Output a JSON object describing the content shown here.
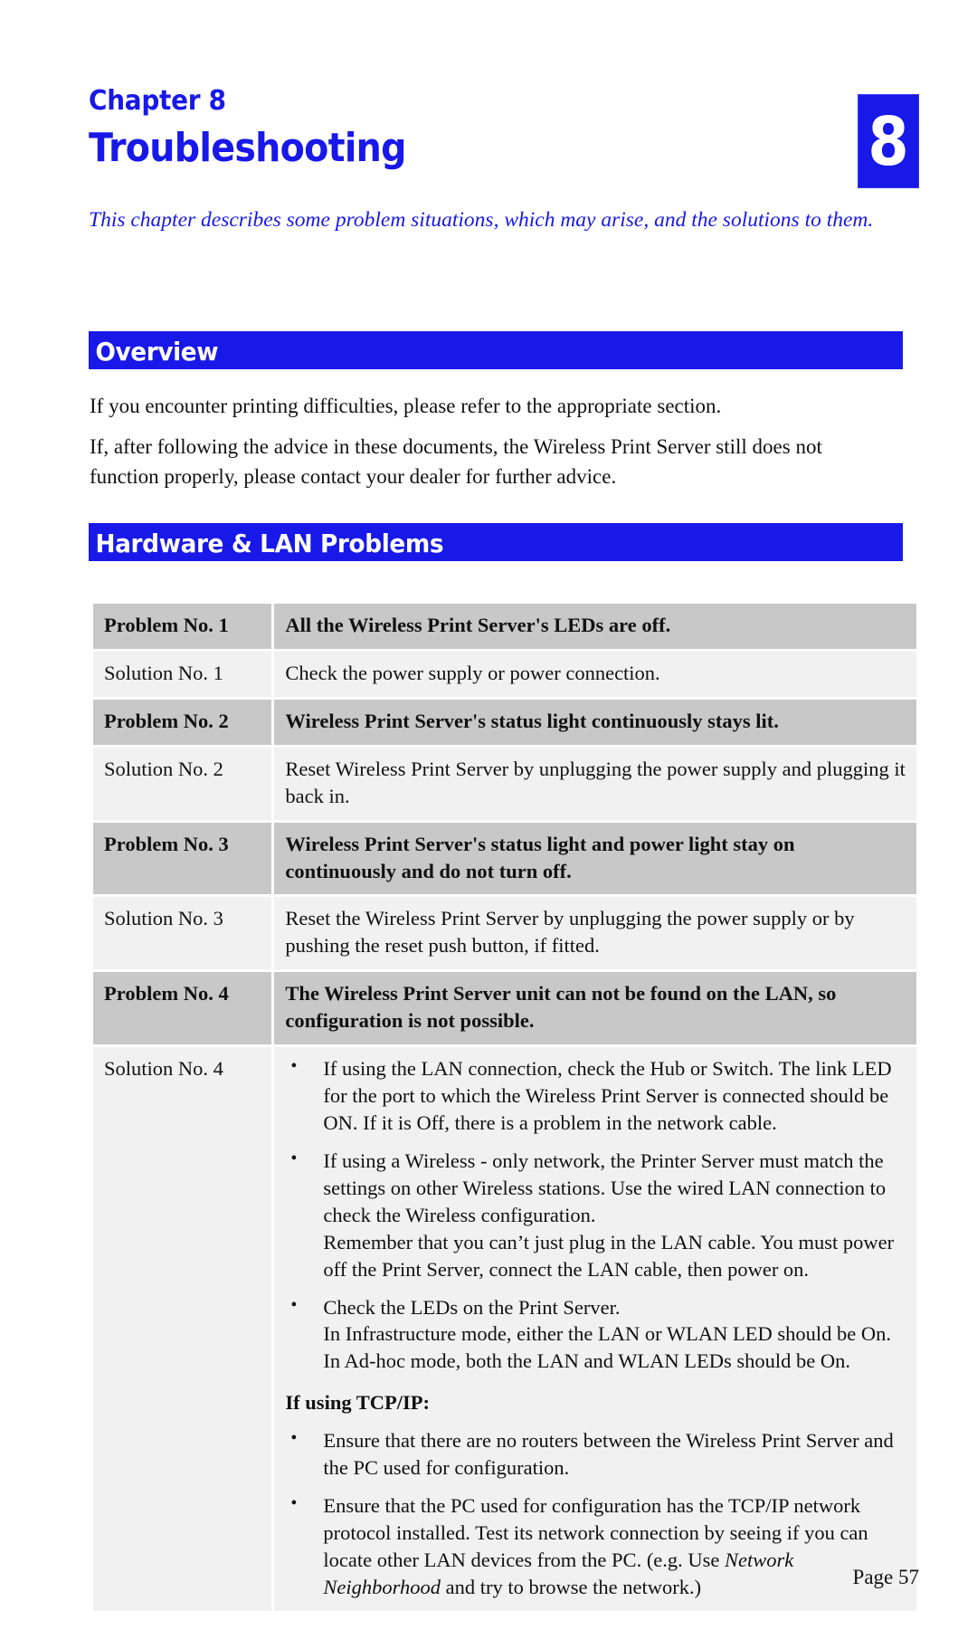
{
  "colors": {
    "accent_blue": "#1818e8",
    "problem_row_bg": "#c8c8c8",
    "solution_row_bg": "#f1f1f1",
    "body_text": "#111111"
  },
  "chapter": {
    "label": "Chapter 8",
    "title": "Troubleshooting",
    "badge_number": "8",
    "intro": "This chapter describes some problem situations, which may arise, and the solutions to them."
  },
  "sections": {
    "overview": {
      "heading": "Overview",
      "paragraphs": [
        "If you encounter printing difficulties, please refer to the appropriate section.",
        "If, after following the advice in these documents, the Wireless Print Server still does not function properly, please contact your dealer for further advice."
      ]
    },
    "hardware_lan": {
      "heading": "Hardware & LAN Problems",
      "rows": [
        {
          "type": "problem",
          "label": "Problem No. 1",
          "text": "All the Wireless Print Server's LEDs are off."
        },
        {
          "type": "solution",
          "label": "Solution No. 1",
          "text": "Check the power supply or power connection."
        },
        {
          "type": "problem",
          "label": "Problem No. 2",
          "text": "Wireless Print Server's status light continuously stays lit."
        },
        {
          "type": "solution",
          "label": "Solution No. 2",
          "text": "Reset Wireless Print Server by unplugging the power supply and plugging it back in."
        },
        {
          "type": "problem",
          "label": "Problem No. 3",
          "text": "Wireless Print Server's status light and power light stay on continuously and do not turn off."
        },
        {
          "type": "solution",
          "label": "Solution No. 3",
          "text": "Reset the Wireless Print Server by unplugging the power supply or by pushing the reset push button, if fitted."
        },
        {
          "type": "problem",
          "label": "Problem No. 4",
          "text": "The Wireless Print Server unit can not be found on the LAN, so configuration is not possible."
        }
      ],
      "solution4": {
        "label": "Solution No. 4",
        "bullets_top": [
          "If using the LAN connection, check the Hub or Switch. The link LED for the port to which the Wireless Print Server is connected should be ON. If it is Off, there is a problem in the network cable.",
          "If using a Wireless - only network, the Printer Server must match the settings on other Wireless stations. Use the wired LAN connection to check the Wireless configuration.\nRemember that you can’t just plug in the LAN cable. You must power off the Print Server, connect the LAN cable, then power on.",
          "Check the LEDs on the Print Server.\nIn Infrastructure mode, either the LAN or WLAN LED should be On.\nIn Ad-hoc mode, both the LAN and WLAN LEDs should be On."
        ],
        "subheading": "If using TCP/IP:",
        "bullets_tcpip": [
          {
            "lead": "Ensure that there are no routers between the Wireless Print Server and the PC used for configuration.",
            "italic": "",
            "tail": ""
          },
          {
            "lead": "Ensure that the PC used for configuration has the TCP/IP network protocol installed. Test its network connection by seeing if you can locate other LAN devices from the PC. (e.g. Use ",
            "italic": "Network Neighborhood",
            "tail": " and try to browse the network.)"
          }
        ]
      }
    }
  },
  "footer": {
    "page_label": "Page 57"
  }
}
